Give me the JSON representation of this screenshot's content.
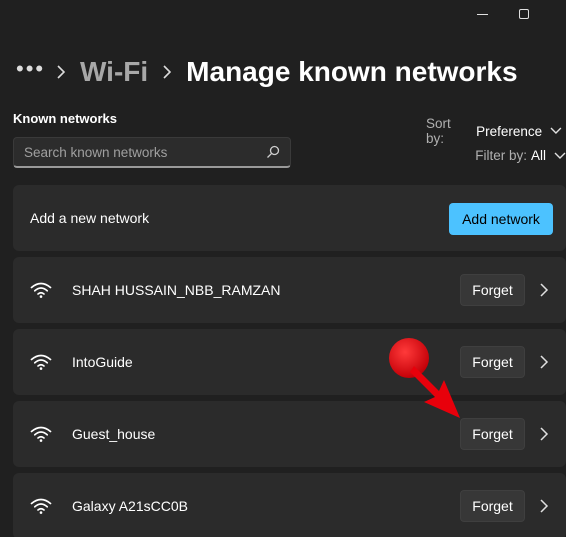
{
  "window": {
    "minimize_icon": "minimize-icon",
    "maximize_icon": "maximize-icon"
  },
  "breadcrumb": {
    "more": "•••",
    "parent": "Wi-Fi",
    "current": "Manage known networks"
  },
  "section_label": "Known networks",
  "search": {
    "placeholder": "Search known networks",
    "value": ""
  },
  "sort": {
    "label": "Sort by:",
    "value": "Preference"
  },
  "filter": {
    "label": "Filter by:",
    "value": "All"
  },
  "add_network": {
    "label": "Add a new network",
    "button": "Add network"
  },
  "networks": [
    {
      "name": "SHAH HUSSAIN_NBB_RAMZAN",
      "button": "Forget"
    },
    {
      "name": "IntoGuide",
      "button": "Forget"
    },
    {
      "name": "Guest_house",
      "button": "Forget"
    },
    {
      "name": "Galaxy A21sCC0B",
      "button": "Forget"
    }
  ],
  "colors": {
    "background": "#202020",
    "card": "#2b2b2b",
    "accent": "#4cc2ff",
    "annotation_red": "#e8000b"
  }
}
